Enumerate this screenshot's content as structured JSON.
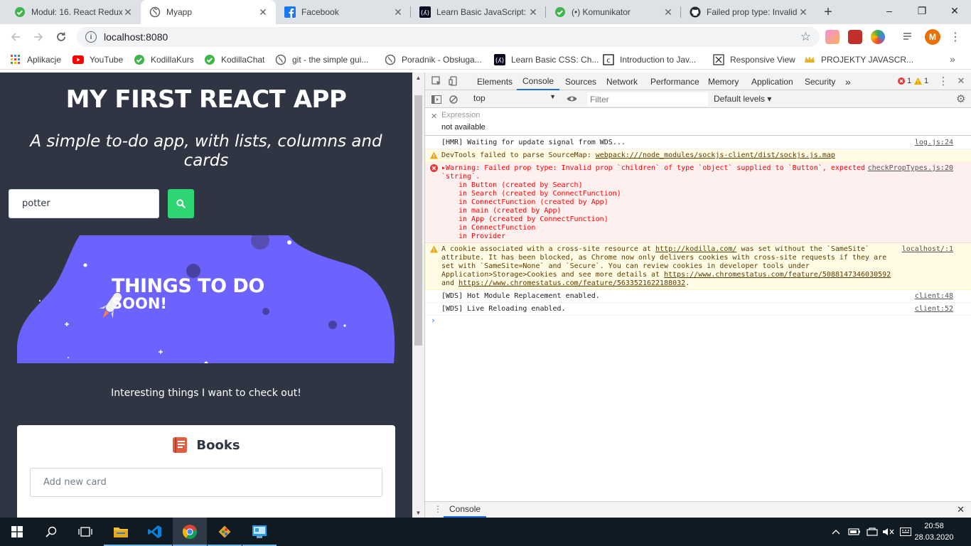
{
  "browser": {
    "tabs": [
      {
        "title": "Moduł: 16. React Redux",
        "icon": "kodilla-icon"
      },
      {
        "title": "Myapp",
        "icon": "globe-icon",
        "active": true
      },
      {
        "title": "Facebook",
        "icon": "facebook-icon"
      },
      {
        "title": "Learn Basic JavaScript: C",
        "icon": "freecodecamp-icon"
      },
      {
        "title": "(•) Komunikator",
        "icon": "kodilla-icon"
      },
      {
        "title": "Failed prop type: Invalid",
        "icon": "github-icon"
      }
    ],
    "window_controls": {
      "minimize": "–",
      "maximize": "❐",
      "close": "✕"
    },
    "address": "localhost:8080",
    "address_info": "i",
    "avatar_letter": "M",
    "bookmarks": [
      {
        "label": "Aplikacje",
        "icon": "apps-grid-icon"
      },
      {
        "label": "YouTube",
        "icon": "youtube-icon"
      },
      {
        "label": "KodillaKurs",
        "icon": "kodilla-icon"
      },
      {
        "label": "KodillaChat",
        "icon": "kodilla-icon"
      },
      {
        "label": "git - the simple gui...",
        "icon": "globe-icon"
      },
      {
        "label": "Poradnik - Obsługa...",
        "icon": "globe-icon"
      },
      {
        "label": "Learn Basic CSS: Ch...",
        "icon": "freecodecamp-icon"
      },
      {
        "label": "Introduction to Jav...",
        "icon": "codecademy-icon"
      },
      {
        "label": "Responsive View",
        "icon": "responsive-icon"
      },
      {
        "label": "PROJEKTY JAVASCR...",
        "icon": "crown-icon"
      }
    ],
    "bookmarks_more": "»"
  },
  "app": {
    "title": "MY FIRST REACT APP",
    "subtitle": "A simple to-do app, with lists, columns and cards",
    "search": {
      "value": "potter"
    },
    "hero": {
      "title": "THINGS TO DO",
      "subtitle": "SOON!"
    },
    "description": "Interesting things I want to check out!",
    "column": {
      "title": "Books",
      "icon": "book-icon",
      "card_placeholder": "Add new card"
    }
  },
  "devtools": {
    "tabs": [
      "Elements",
      "Console",
      "Sources",
      "Network",
      "Performance",
      "Memory",
      "Application",
      "Security"
    ],
    "active_tab": "Console",
    "more_tabs": "»",
    "error_count": "1",
    "warning_count": "1",
    "context": "top",
    "filter_placeholder": "Filter",
    "levels": "Default levels ▾",
    "expression": {
      "label": "Expression",
      "value": "not available"
    },
    "messages": [
      {
        "type": "log",
        "text": "[HMR] Waiting for update signal from WDS...",
        "source": "log.js:24"
      },
      {
        "type": "warn",
        "text": "DevTools failed to parse SourceMap: ",
        "link": "webpack:///node_modules/sockjs-client/dist/sockjs.js.map",
        "source": ""
      },
      {
        "type": "error",
        "text": "▸Warning: Failed prop type: Invalid prop `children` of type `object` supplied to `Button`, expected `string`.",
        "source": "checkPropTypes.js:20",
        "stack": [
          "in Button (created by Search)",
          "in Search (created by ConnectFunction)",
          "in ConnectFunction (created by App)",
          "in main (created by App)",
          "in App (created by ConnectFunction)",
          "in ConnectFunction",
          "in Provider"
        ]
      },
      {
        "type": "warn",
        "text_1": "A cookie associated with a cross-site resource at ",
        "link_1": "http://kodilla.com/",
        "text_2": " was set without the `SameSite` attribute. It has been blocked, as Chrome now only delivers cookies with cross-site requests if they are set with `SameSite=None` and `Secure`. You can review cookies in developer tools under Application>Storage>Cookies and see more details at ",
        "link_2": "https://www.chromestatus.com/feature/5088147346030592",
        "text_3": " and ",
        "link_3": "https://www.chromestatus.com/feature/5633521622188032",
        "text_4": ".",
        "source": "localhost/:1"
      },
      {
        "type": "log",
        "text": "[WDS] Hot Module Replacement enabled.",
        "source": "client:48"
      },
      {
        "type": "log",
        "text": "[WDS] Live Reloading enabled.",
        "source": "client:52"
      }
    ],
    "drawer_tab": "Console"
  },
  "taskbar": {
    "time": "20:58",
    "date": "28.03.2020",
    "apps": [
      "windows-start-icon",
      "search-icon",
      "task-view-icon",
      "file-explorer-icon",
      "vscode-icon",
      "chrome-icon",
      "git-icon",
      "control-panel-icon"
    ]
  },
  "colors": {
    "page_bg": "#2f3542",
    "accent_green": "#2ed573",
    "hero_purple": "#6c63ff",
    "error_red": "#ff0000"
  }
}
